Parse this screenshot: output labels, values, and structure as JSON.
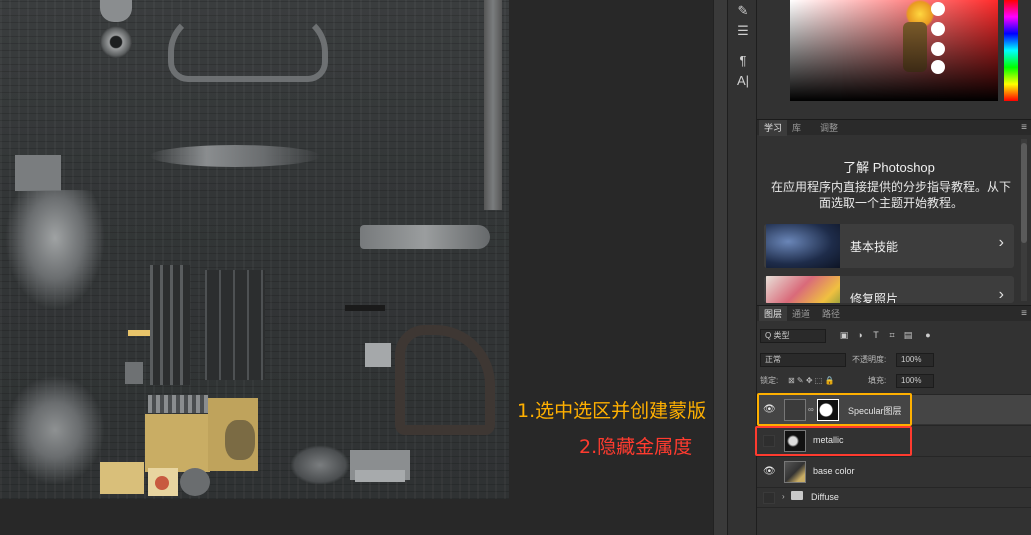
{
  "learn_panel": {
    "tabs": [
      "学习",
      "库",
      "调整"
    ],
    "title": "了解 Photoshop",
    "description": "在应用程序内直接提供的分步指导教程。从下面选取一个主题开始教程。",
    "cards": [
      {
        "label": "基本技能",
        "arrow": "›"
      },
      {
        "label": "修复照片",
        "arrow": "›"
      }
    ]
  },
  "layers_panel": {
    "tabs": [
      "图层",
      "通道",
      "路径"
    ],
    "filter_kind": "Q 类型",
    "blend_mode": "正常",
    "opacity_label": "不透明度:",
    "opacity_value": "100%",
    "lock_label": "锁定:",
    "fill_label": "填充:",
    "fill_value": "100%",
    "layers": [
      {
        "name": "Specular图层",
        "visible": true,
        "selected": true
      },
      {
        "name": "metallic",
        "visible": false,
        "selected": false
      },
      {
        "name": "base color",
        "visible": true,
        "selected": false
      },
      {
        "name": "Diffuse",
        "visible": false,
        "selected": false,
        "is_group": true
      }
    ]
  },
  "annotations": {
    "step1": "1.选中选区并创建蒙版",
    "step2": "2.隐藏金属度",
    "step1_color": "#ffb000",
    "step2_color": "#ff3b2f"
  },
  "icons": [
    "brush-icon",
    "sliders-icon",
    "paragraph-icon",
    "character-icon",
    "eye-icon",
    "folder-icon",
    "chain-link-icon",
    "menu-icon"
  ]
}
